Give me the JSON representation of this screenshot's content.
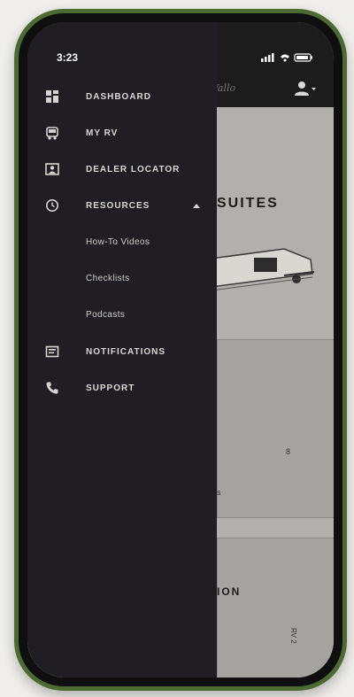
{
  "status": {
    "time": "3:23"
  },
  "background_page": {
    "header_script": "Vallo",
    "title_top": "SUITES",
    "title_bottom": "ION",
    "small_text_1": "8",
    "small_text_2": "s",
    "vertical_text": "RV 2"
  },
  "menu": {
    "items": [
      {
        "label": "DASHBOARD",
        "icon": "dashboard-icon"
      },
      {
        "label": "MY RV",
        "icon": "rv-icon"
      },
      {
        "label": "DEALER LOCATOR",
        "icon": "dealer-icon"
      },
      {
        "label": "RESOURCES",
        "icon": "resources-icon"
      },
      {
        "label": "NOTIFICATIONS",
        "icon": "notifications-icon"
      },
      {
        "label": "SUPPORT",
        "icon": "phone-icon"
      }
    ],
    "resources_sub": [
      {
        "label": "How-To Videos"
      },
      {
        "label": "Checklists"
      },
      {
        "label": "Podcasts"
      }
    ]
  },
  "colors": {
    "phone_case": "#4b6b33",
    "drawer_bg": "#201e22",
    "header_bg": "#1d1c1d"
  }
}
